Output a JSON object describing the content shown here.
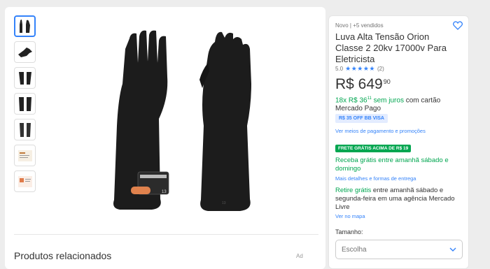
{
  "gallery": {
    "thumbnail_count": 7,
    "selected_index": 0,
    "thumbnails": [
      "glove-pair",
      "glove-single-flat",
      "glove-pair",
      "glove-pair-dark",
      "glove-pair-dark",
      "product-document",
      "product-certificate"
    ]
  },
  "related": {
    "title": "Produtos relacionados",
    "ad_label": "Ad"
  },
  "product": {
    "condition": "Novo",
    "separator": "|",
    "sold": "+5 vendidos",
    "title": "Luva Alta Tensão Orion Classe 2 20kv 17000v Para Eletricista",
    "rating_value": "5.0",
    "stars": "★★★★★",
    "rating_count": "(2)",
    "price_main": "R$ 649",
    "price_cents": "90",
    "installments_green": "18x R$ 36",
    "installments_cents": "11",
    "installments_tail_green": " sem juros",
    "installments_rest": " com cartão Mercado Pago",
    "promo_badge": "R$ 35 OFF BB VISA",
    "payment_link": "Ver meios de pagamento e promoções"
  },
  "shipping": {
    "free_badge": "FRETE GRÁTIS ACIMA DE R$ 19",
    "delivery_text": "Receba grátis entre amanhã sábado e domingo",
    "details_link": "Mais detalhes e formas de entrega",
    "pickup_green": "Retire grátis",
    "pickup_rest": " entre amanhã sábado e segunda-feira em uma agência Mercado Livre",
    "map_link": "Ver no mapa"
  },
  "quantity": {
    "label": "Tamanho:",
    "placeholder": "Escolha"
  },
  "colors": {
    "accent": "#3483fa",
    "green": "#00a650",
    "background": "#ededed"
  }
}
